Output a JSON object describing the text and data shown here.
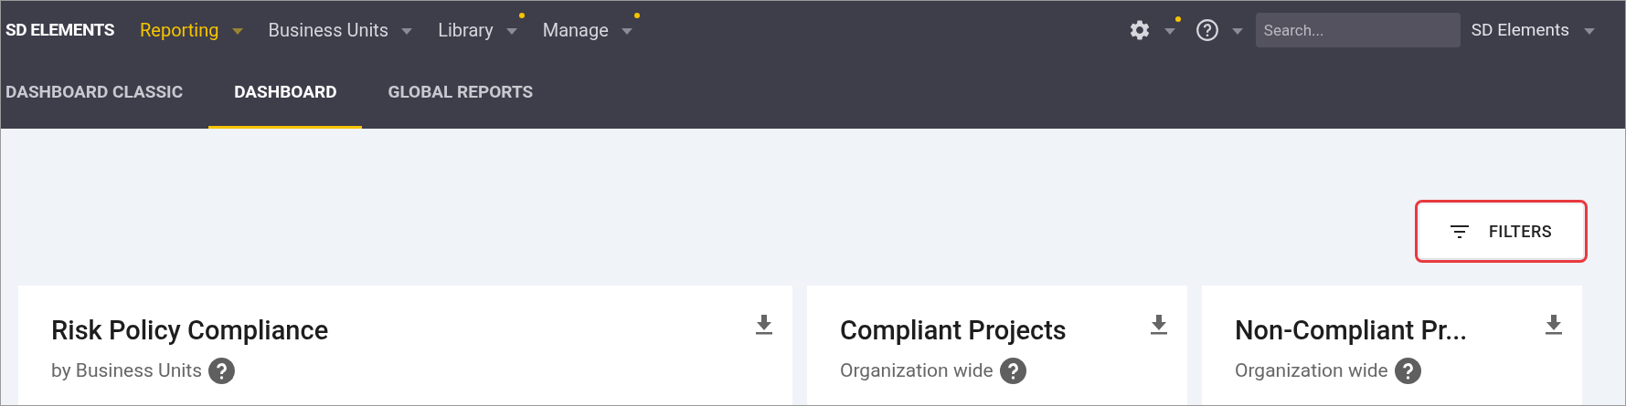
{
  "logo": "SD ELEMENTS",
  "nav": [
    {
      "label": "Reporting",
      "selected": true,
      "badge": false
    },
    {
      "label": "Business Units",
      "selected": false,
      "badge": false
    },
    {
      "label": "Library",
      "selected": false,
      "badge": true
    },
    {
      "label": "Manage",
      "selected": false,
      "badge": true
    }
  ],
  "toolbar": {
    "settings_badge": true,
    "search": {
      "placeholder": "Search..."
    },
    "account": "SD Elements"
  },
  "tabs": [
    {
      "label": "DASHBOARD CLASSIC",
      "selected": false
    },
    {
      "label": "DASHBOARD",
      "selected": true
    },
    {
      "label": "GLOBAL REPORTS",
      "selected": false
    }
  ],
  "filters_button": {
    "label": "FILTERS",
    "highlighted": true
  },
  "cards": [
    {
      "title": "Risk Policy Compliance",
      "subtitle": "by Business Units"
    },
    {
      "title": "Compliant Projects",
      "subtitle": "Organization wide"
    },
    {
      "title": "Non-Compliant Pr...",
      "subtitle": "Organization wide"
    }
  ]
}
